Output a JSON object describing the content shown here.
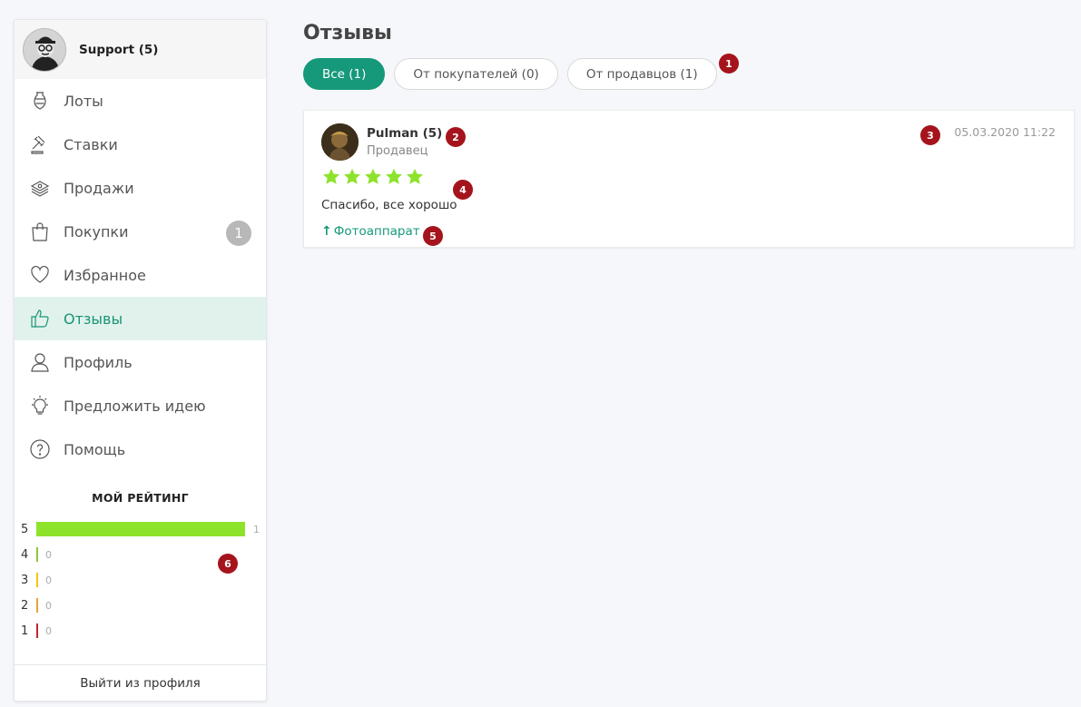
{
  "user": {
    "name": "Support (5)"
  },
  "sidebar": {
    "items": [
      {
        "label": "Лоты",
        "icon": "vase-icon"
      },
      {
        "label": "Ставки",
        "icon": "gavel-icon"
      },
      {
        "label": "Продажи",
        "icon": "money-stack-icon"
      },
      {
        "label": "Покупки",
        "icon": "shopping-bag-icon",
        "badge": "1"
      },
      {
        "label": "Избранное",
        "icon": "heart-icon"
      },
      {
        "label": "Отзывы",
        "icon": "thumbs-up-icon",
        "active": true
      },
      {
        "label": "Профиль",
        "icon": "user-icon"
      },
      {
        "label": "Предложить идею",
        "icon": "lightbulb-icon"
      },
      {
        "label": "Помощь",
        "icon": "help-circle-icon"
      }
    ],
    "rating": {
      "title": "МОЙ РЕЙТИНГ",
      "rows": [
        {
          "stars": "5",
          "count": "1",
          "color": "#8de32a"
        },
        {
          "stars": "4",
          "count": "0",
          "color": "#8dc63f"
        },
        {
          "stars": "3",
          "count": "0",
          "color": "#f5c518"
        },
        {
          "stars": "2",
          "count": "0",
          "color": "#e8a33a"
        },
        {
          "stars": "1",
          "count": "0",
          "color": "#c0262d"
        }
      ]
    },
    "logout_label": "Выйти из профиля"
  },
  "main": {
    "title": "Отзывы",
    "tabs": [
      {
        "label": "Все (1)",
        "active": true
      },
      {
        "label": "От покупателей (0)"
      },
      {
        "label": "От продавцов (1)"
      }
    ],
    "review": {
      "author": "Pulman (5)",
      "role": "Продавец",
      "date": "05.03.2020 11:22",
      "rating": 5,
      "text": "Спасибо, все хорошо",
      "link_label": "Фотоаппарат"
    }
  },
  "markers": [
    "1",
    "2",
    "3",
    "4",
    "5",
    "6"
  ],
  "colors": {
    "accent": "#16997a",
    "star": "#8de32a",
    "marker": "#a5141c",
    "active_bg": "#e1f2ec"
  }
}
